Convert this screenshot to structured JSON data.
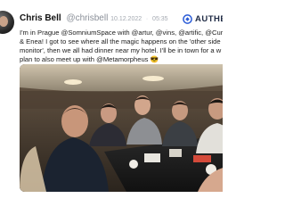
{
  "post": {
    "author_name": "Chris Bell",
    "handle": "@chrisbell",
    "separator": "·",
    "date": "10.12.2022",
    "time_partial": "05:35",
    "brand_name": "AUTHEN",
    "brand_icon": "brand-logo-icon",
    "text_lines": [
      "I'm in Prague @SomniumSpace with @artur, @vins, @artific, @Curio",
      "& Enea! I got to see where all the magic happens on the 'other side of the",
      "monitor', then we all had dinner near my hotel. I'll be in town for a w",
      "plan to also meet up with @Metamorpheus 😎"
    ]
  },
  "photo": {
    "description_icon": "group-selfie-photo"
  }
}
